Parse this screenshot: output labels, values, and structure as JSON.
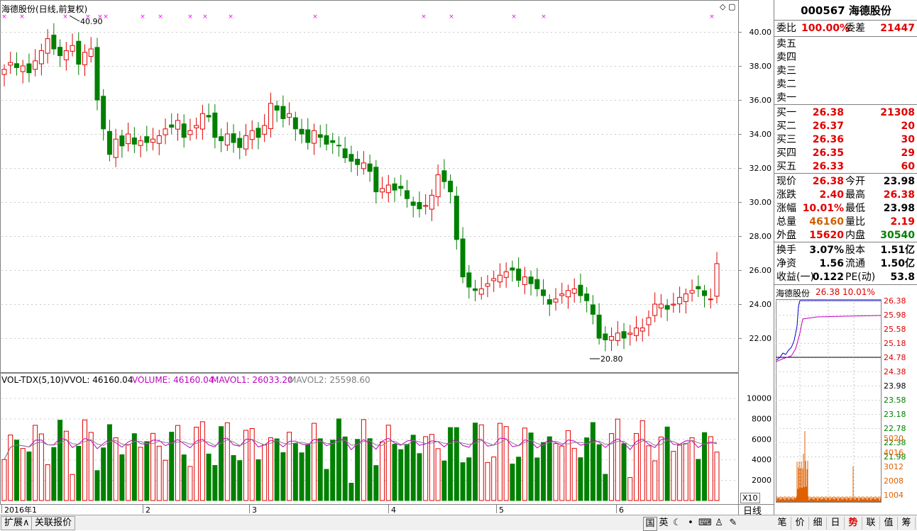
{
  "main_title": "海德股份(日线,前复权)",
  "price_axis_labels": [
    "40.00",
    "38.00",
    "36.00",
    "34.00",
    "32.00",
    "30.00",
    "28.00",
    "26.00",
    "24.00",
    "22.00"
  ],
  "high_marker": "40.90",
  "low_marker": "20.80",
  "volume_header": {
    "indicator": "VOL-TDX(5,10)",
    "vvol": "VVOL: 46160.04",
    "volume": "VOLUME: 46160.04",
    "mavol1": "MAVOL1: 26033.20",
    "mavol2": "MAVOL2: 25598.60"
  },
  "volume_axis_labels": [
    "10000",
    "8000",
    "6000",
    "4000",
    "2000"
  ],
  "volume_scale_label": "X10",
  "date_axis_labels": [
    "2016年1",
    "2",
    "3",
    "4",
    "5",
    "6"
  ],
  "colors": {
    "up": "#e00000",
    "down": "#008000",
    "ma1": "#c000c0",
    "ma2": "#808080",
    "marker": "#ff00ff"
  },
  "quote": {
    "code_name": "000567 海德股份",
    "weibi_label": "委比",
    "weibi_value": "100.00%",
    "weicha_label": "委差",
    "weicha_value": "21447",
    "sell": [
      {
        "label": "卖五",
        "price": "",
        "vol": ""
      },
      {
        "label": "卖四",
        "price": "",
        "vol": ""
      },
      {
        "label": "卖三",
        "price": "",
        "vol": ""
      },
      {
        "label": "卖二",
        "price": "",
        "vol": ""
      },
      {
        "label": "卖一",
        "price": "",
        "vol": ""
      }
    ],
    "buy": [
      {
        "label": "买一",
        "price": "26.38",
        "vol": "21308"
      },
      {
        "label": "买二",
        "price": "26.37",
        "vol": "20"
      },
      {
        "label": "买三",
        "price": "26.36",
        "vol": "30"
      },
      {
        "label": "买四",
        "price": "26.35",
        "vol": "29"
      },
      {
        "label": "买五",
        "price": "26.33",
        "vol": "60"
      }
    ],
    "stats": [
      {
        "l1": "现价",
        "v1": "26.38",
        "c1": "red",
        "l2": "今开",
        "v2": "23.98",
        "c2": "black"
      },
      {
        "l1": "涨跌",
        "v1": "2.40",
        "c1": "red",
        "l2": "最高",
        "v2": "26.38",
        "c2": "red"
      },
      {
        "l1": "涨幅",
        "v1": "10.01%",
        "c1": "red",
        "l2": "最低",
        "v2": "23.98",
        "c2": "black"
      },
      {
        "l1": "总量",
        "v1": "46160",
        "c1": "orange",
        "l2": "量比",
        "v2": "2.19",
        "c2": "red"
      },
      {
        "l1": "外盘",
        "v1": "15620",
        "c1": "red",
        "l2": "内盘",
        "v2": "30540",
        "c2": "green"
      }
    ],
    "stats2": [
      {
        "l1": "换手",
        "v1": "3.07%",
        "l2": "股本",
        "v2": "1.51亿"
      },
      {
        "l1": "净资",
        "v1": "1.56",
        "l2": "流通",
        "v2": "1.50亿"
      },
      {
        "l1": "收益(一)",
        "v1": "0.122",
        "l2": "PE(动)",
        "v2": "53.8"
      }
    ]
  },
  "mini_chart": {
    "title": "海德股份",
    "price": "26.38",
    "pct": "10.01%",
    "price_labels": [
      "26.38",
      "25.98",
      "25.58",
      "25.18",
      "24.78",
      "24.38",
      "23.98",
      "23.58",
      "23.18",
      "22.78",
      "22.38",
      "21.98"
    ],
    "vol_labels": [
      "5020",
      "4016",
      "3012",
      "2008",
      "1004"
    ]
  },
  "bottom_tabs": [
    "扩展∧",
    "关联报价"
  ],
  "period_tab": "日线",
  "ime_chars": [
    "国",
    "英"
  ],
  "right_tabs": [
    "笔",
    "价",
    "细",
    "日",
    "势",
    "联",
    "值",
    "筹"
  ],
  "active_right_tab": "势"
}
